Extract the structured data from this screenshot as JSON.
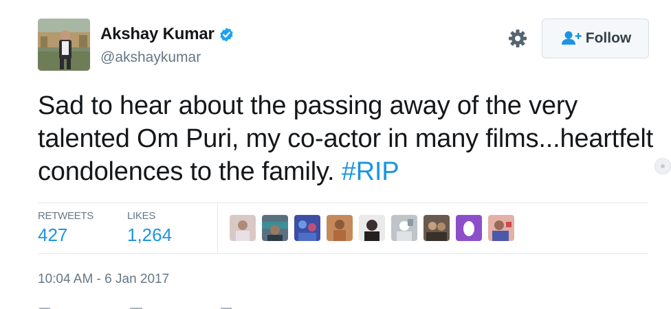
{
  "author": {
    "display_name": "Akshay Kumar",
    "handle": "@akshaykumar",
    "verified": true,
    "avatar_icon": "profile-photo"
  },
  "header": {
    "settings_icon": "gear-icon",
    "follow_label": "Follow"
  },
  "tweet": {
    "text_parts": [
      "Sad to hear about the passing away of the very talented Om Puri, my co-actor in many films...heartfelt condolences to the family. ",
      "#RIP"
    ]
  },
  "stats": {
    "retweets_label": "RETWEETS",
    "retweets_value": "427",
    "likes_label": "LIKES",
    "likes_value": "1,264"
  },
  "timestamp": "10:04 AM - 6 Jan 2017",
  "colors": {
    "link": "#1b95e0",
    "muted": "#657786",
    "text": "#14171a",
    "border": "#e1e8ed"
  }
}
